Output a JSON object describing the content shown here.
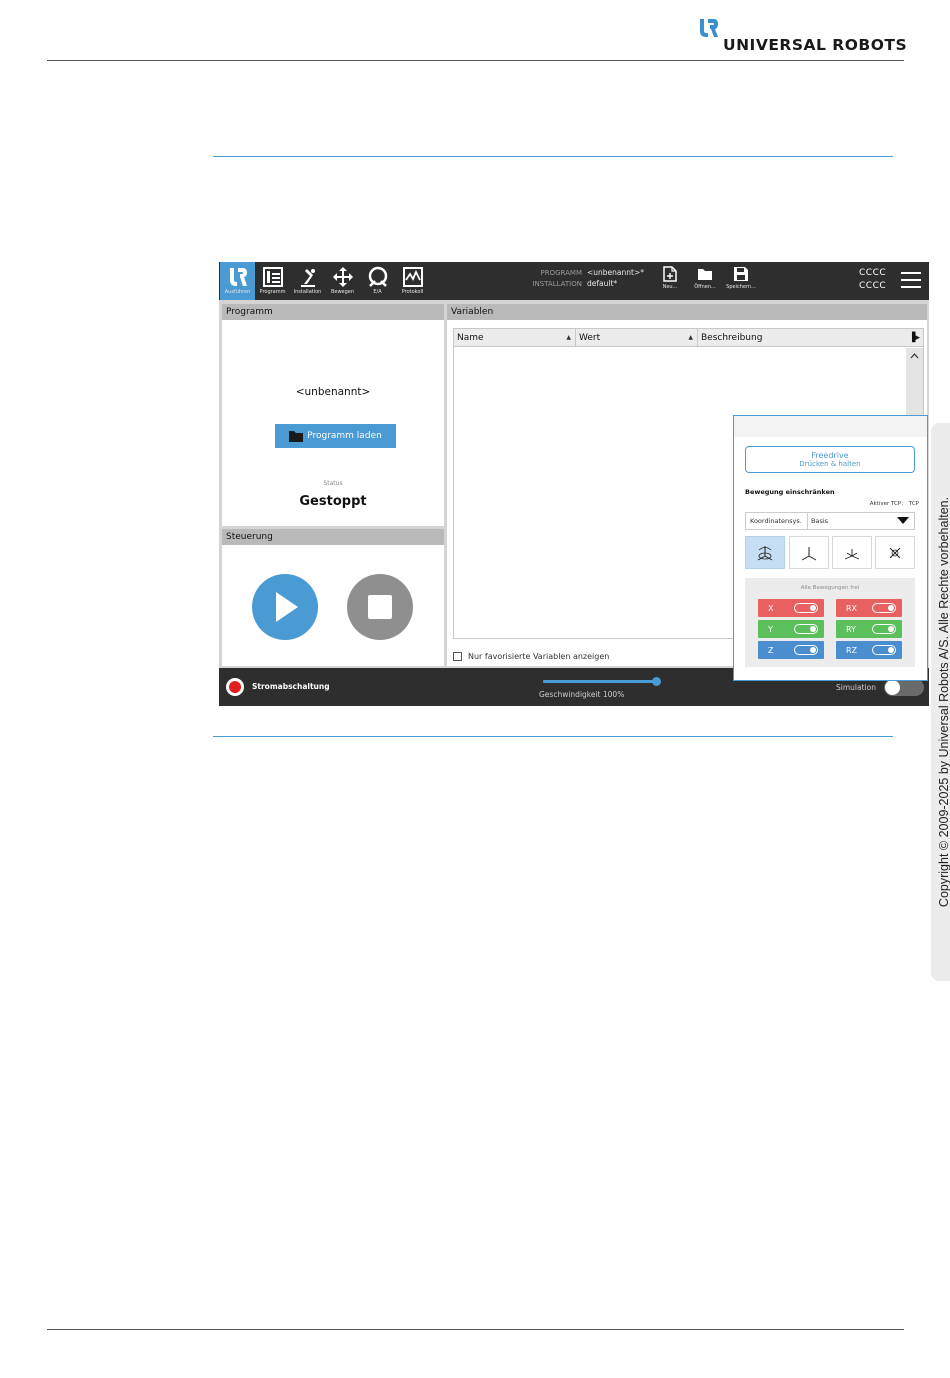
{
  "brand": {
    "logo_mark": "UR",
    "logo_text": "UNIVERSAL ROBOTS"
  },
  "copyright": "Copyright © 2009-2025 by Universal Robots A/S. Alle Rechte vorbehalten.",
  "colors": {
    "accent": "#4a9ad4",
    "topbar": "#2e2e2e",
    "stop": "#e02020",
    "x_axis": "#e96060",
    "y_axis": "#5bbf5b",
    "z_axis": "#4a8ed0"
  },
  "ui": {
    "nav": [
      {
        "label": "Ausführen",
        "icon": "run-icon",
        "active": true
      },
      {
        "label": "Programm",
        "icon": "program-icon",
        "active": false
      },
      {
        "label": "Installation",
        "icon": "installation-icon",
        "active": false
      },
      {
        "label": "Bewegen",
        "icon": "move-icon",
        "active": false
      },
      {
        "label": "E/A",
        "icon": "io-icon",
        "active": false
      },
      {
        "label": "Protokoll",
        "icon": "log-icon",
        "active": false
      }
    ],
    "program": {
      "label": "PROGRAMM",
      "value": "<unbenannt>*"
    },
    "installation": {
      "label": "INSTALLATION",
      "value": "default*"
    },
    "file_buttons": [
      {
        "label": "Neu...",
        "icon": "new-file-icon"
      },
      {
        "label": "Öffnen...",
        "icon": "open-folder-icon"
      },
      {
        "label": "Speichern...",
        "icon": "save-icon"
      }
    ],
    "user": {
      "line1": "CCCC",
      "line2": "CCCC"
    },
    "programm_panel": {
      "title": "Programm",
      "name": "<unbenannt>",
      "load_button": "Programm laden",
      "status_label": "Status",
      "status_value": "Gestoppt"
    },
    "steuerung_panel": {
      "title": "Steuerung"
    },
    "variablen_panel": {
      "title": "Variablen",
      "columns": [
        "Name",
        "Wert",
        "Beschreibung"
      ],
      "favorites_checkbox": "Nur favorisierte Variablen anzeigen"
    },
    "bottom": {
      "power_label": "Stromabschaltung",
      "speed_label": "Geschwindigkeit 100%",
      "speed_fraction": 1.0,
      "simulation_label": "Simulation"
    },
    "freedrive": {
      "button_title": "Freedrive",
      "button_sub": "Drücken & halten",
      "constraint_title": "Bewegung einschränken",
      "active_tcp_label": "Aktiver TCP:",
      "active_tcp_value": "TCP",
      "coord_label": "Koordinatensys.",
      "coord_value": "Basis",
      "all_free_label": "Alle Bewegungen frei",
      "axes": [
        {
          "label": "X",
          "color": "#e96060"
        },
        {
          "label": "RX",
          "color": "#e96060"
        },
        {
          "label": "Y",
          "color": "#5bbf5b"
        },
        {
          "label": "RY",
          "color": "#5bbf5b"
        },
        {
          "label": "Z",
          "color": "#4a8ed0"
        },
        {
          "label": "RZ",
          "color": "#4a8ed0"
        }
      ]
    }
  }
}
